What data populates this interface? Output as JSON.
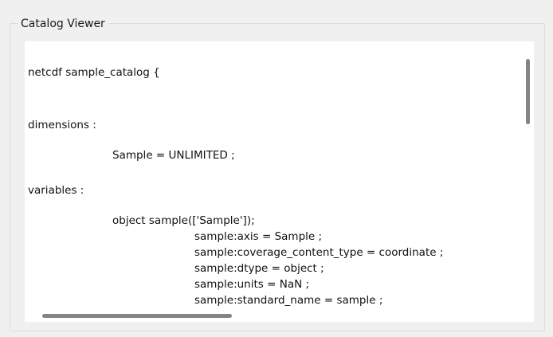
{
  "groupbox": {
    "title": "Catalog Viewer"
  },
  "viewer": {
    "lines": [
      "netcdf sample_catalog {",
      "dimensions :",
      "Sample = UNLIMITED ;",
      "variables :",
      "object sample(['Sample']);",
      "sample:axis = Sample ;",
      "sample:coverage_content_type = coordinate ;",
      "sample:dtype = object ;",
      "sample:units = NaN ;",
      "sample:standard_name = sample ;"
    ]
  },
  "colors": {
    "window_bg": "#f0f0f0",
    "viewer_bg": "#ffffff",
    "scroll_thumb": "#848484",
    "border": "#dcdcdc"
  }
}
